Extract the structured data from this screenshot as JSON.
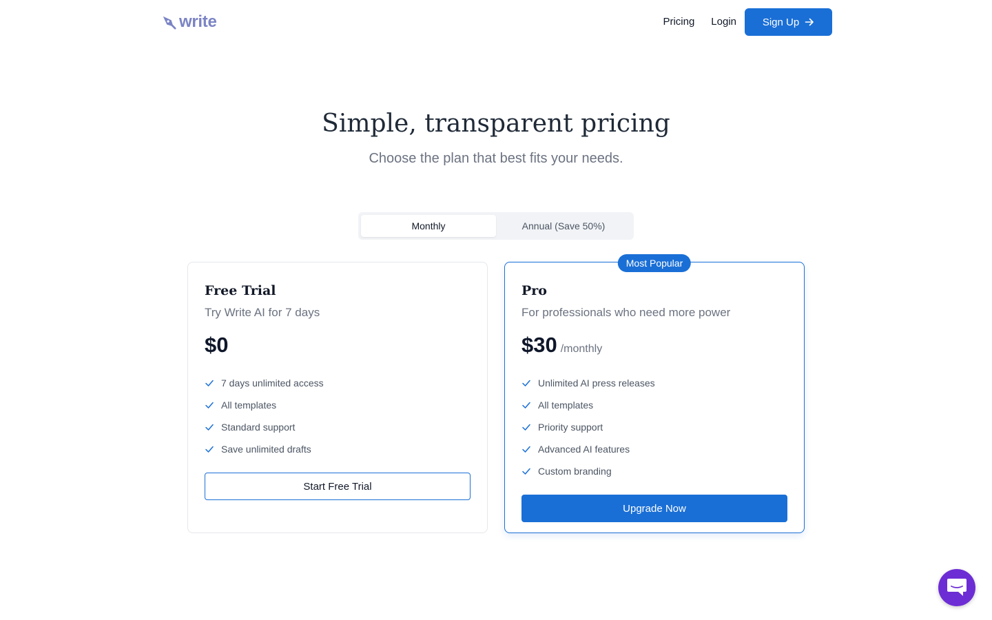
{
  "brand": {
    "name": "write",
    "color": "#7b84c4",
    "icon": "pen-nib-icon"
  },
  "nav": {
    "pricing": "Pricing",
    "login": "Login",
    "signup": "Sign Up",
    "signup_icon": "arrow-right-icon"
  },
  "hero": {
    "title": "Simple, transparent pricing",
    "subtitle": "Choose the plan that best fits your needs."
  },
  "billing_toggle": {
    "monthly": "Monthly",
    "annual": "Annual (Save 50%)",
    "selected": "Monthly"
  },
  "plans": [
    {
      "name": "Free Trial",
      "description": "Try Write AI for 7 days",
      "price": "$0",
      "period": "",
      "features": [
        "7 days unlimited access",
        "All templates",
        "Standard support",
        "Save unlimited drafts"
      ],
      "cta": "Start Free Trial"
    },
    {
      "name": "Pro",
      "badge": "Most Popular",
      "description": "For professionals who need more power",
      "price": "$30",
      "period": "/monthly",
      "features": [
        "Unlimited AI press releases",
        "All templates",
        "Priority support",
        "Advanced AI features",
        "Custom branding"
      ],
      "cta": "Upgrade Now"
    }
  ],
  "colors": {
    "primary": "#1a6fd6",
    "chat": "#6d2dd4",
    "check": "#1a6fd6"
  },
  "chat_widget": {
    "icon": "chat-bubble-icon"
  }
}
